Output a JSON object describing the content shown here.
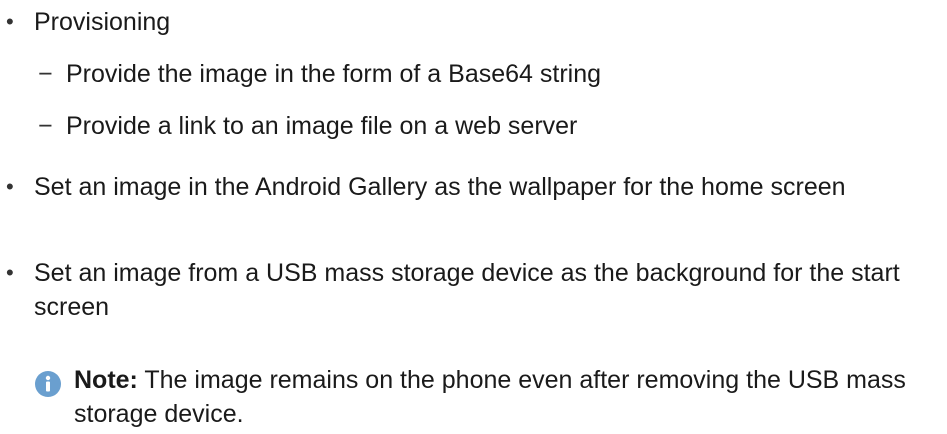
{
  "bullets": {
    "item1": {
      "marker": "•",
      "text": "Provisioning"
    },
    "sub1": {
      "marker": "−",
      "text": "Provide the image in the form of a Base64 string"
    },
    "sub2": {
      "marker": "−",
      "text": "Provide a link to an image file on a web server"
    },
    "item2": {
      "marker": "•",
      "text": "Set an image in the Android Gallery as the wallpaper for the home screen"
    },
    "item3": {
      "marker": "•",
      "text": "Set an image from a USB mass storage device as the background for the start screen"
    }
  },
  "note": {
    "icon": "info-icon",
    "label": "Note:",
    "text": " The image remains on the phone even after removing the USB mass storage device."
  },
  "colors": {
    "text": "#1a1a1a",
    "info_icon": "#6a9fcf"
  }
}
